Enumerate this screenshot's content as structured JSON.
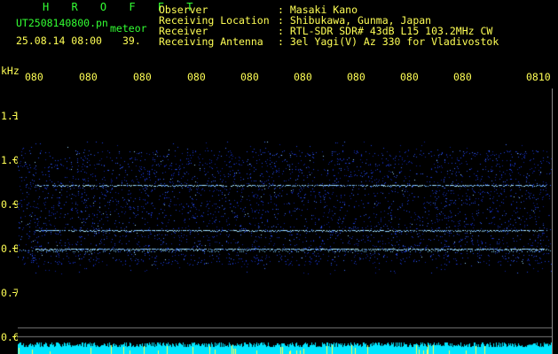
{
  "header": {
    "logo": "H R O F F T",
    "filename": "UT2508140800.pn",
    "meteor_label": "meteor",
    "timestamp": "25.08.14 08:00",
    "count": "39.",
    "info_labels": [
      "Observer",
      "Receiving Location",
      "Receiver",
      "Receiving Antenna"
    ],
    "info_values": [
      ": Masaki Kano",
      ": Shibukawa, Gunma, Japan",
      ": RTL-SDR SDR# 43dB L15 103.2MHz CW",
      ": 3el Yagi(V) Az 330 for Vladivostok"
    ]
  },
  "x_axis": {
    "tick_labels": [
      "080",
      "080",
      "080",
      "080",
      "080",
      "080",
      "080",
      "080",
      "080",
      "0810"
    ]
  },
  "y_axis": {
    "unit": "kHz",
    "tick_labels": [
      "1.1",
      "1.0",
      "0.9",
      "0.8",
      "0.7",
      "0.6"
    ]
  },
  "colors": {
    "text_green": "#33ff33",
    "text_yellow": "#ffff55",
    "noise_blue": "#1a3cff",
    "trace_cyan": "#b4f0ff",
    "bar_cyan": "#00e5ff"
  }
}
